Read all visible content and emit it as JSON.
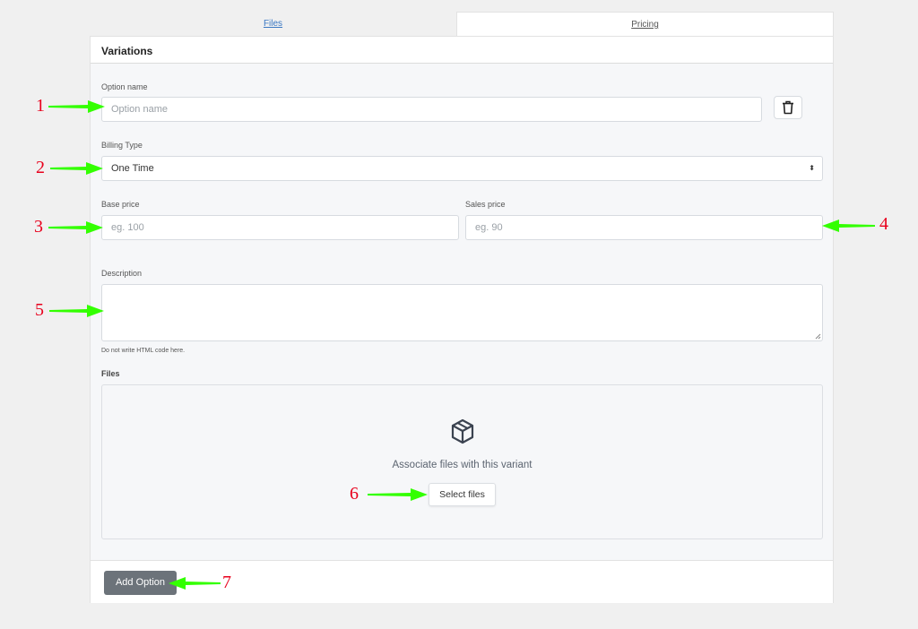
{
  "tabs": {
    "files": "Files",
    "pricing": "Pricing"
  },
  "panel": {
    "title": "Variations"
  },
  "option_name": {
    "label": "Option name",
    "placeholder": "Option name",
    "value": ""
  },
  "billing_type": {
    "label": "Billing Type",
    "value": "One Time",
    "caret": "⬍"
  },
  "base_price": {
    "label": "Base price",
    "placeholder": "eg. 100"
  },
  "sales_price": {
    "label": "Sales price",
    "placeholder": "eg. 90"
  },
  "description": {
    "label": "Description",
    "help": "Do not write HTML code here."
  },
  "files": {
    "label": "Files",
    "dropzone_text": "Associate files with this variant",
    "select_button": "Select files"
  },
  "footer": {
    "add_option": "Add Option"
  },
  "annotations": [
    "1",
    "2",
    "3",
    "4",
    "5",
    "6",
    "7"
  ],
  "colors": {
    "arrow": "#33ff00",
    "annotation_number": "#e8001c",
    "add_button": "#6c737a",
    "link": "#3a78c3"
  },
  "icons": {
    "delete": "trash-icon",
    "package": "box-icon"
  }
}
